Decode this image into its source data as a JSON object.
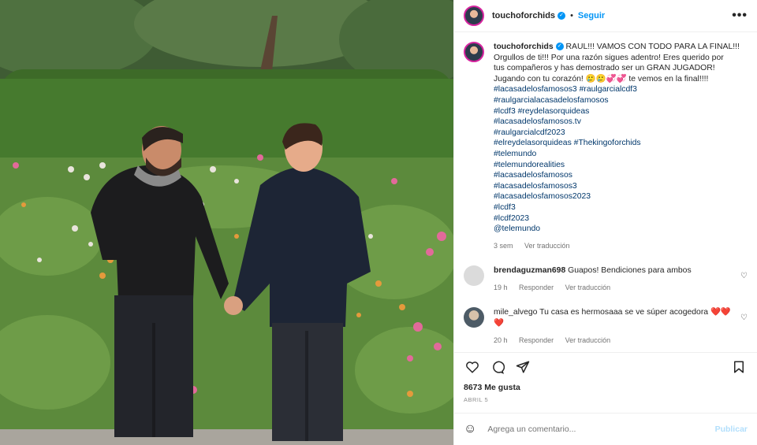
{
  "post": {
    "username": "touchoforchids",
    "follow_label": "Seguir",
    "more_label": "•••",
    "caption_lines": [
      "RAUL!!! VAMOS CON TODO PARA LA FINAL!!!",
      "Orgullos de ti!!! Por una razón sigues adentro! Eres querido por",
      "tus compañeros y has demostrado ser un GRAN JUGADOR!",
      "Jugando con tu corazón! 🥲🥲💞💞 te vemos en la final!!!!"
    ],
    "hashtags": [
      "#lacasadelosfamosos3 #raulgarcialcdf3",
      "#raulgarcialacasadelosfamosos",
      "#lcdf3 #reydelasorquideas",
      "#lacasadelosfamosos.tv",
      "#raulgarcialcdf2023",
      "#elreydelasorquideas #Thekingoforchids",
      "#telemundo",
      "#telemundorealities",
      "#lacasadelosfamosos",
      "#lacasadelosfamosos3",
      "#lacasadelosfamosos2023",
      "#lcdf3",
      "#lcdf2023",
      "@telemundo"
    ],
    "caption_time": "3 sem",
    "translate_label": "Ver traducción",
    "reply_label": "Responder",
    "likes": "8673 Me gusta",
    "date": "ABRIL 5",
    "comment_placeholder": "Agrega un comentario...",
    "publish_label": "Publicar"
  },
  "comments": [
    {
      "user": "brendaguzman698",
      "text": "Guapos! Bendiciones para ambos",
      "time": "19 h"
    },
    {
      "user": "mile_alvego",
      "text": "Tu casa es hermosaaa se ve súper acogedora",
      "hearts": "❤️❤️❤️",
      "time": "20 h"
    }
  ],
  "colors": {
    "accent": "#0095f6",
    "hashtag": "#00376b",
    "muted": "#737373",
    "heart": "#ed4956"
  },
  "icons": [
    "verified-icon",
    "more-options-icon",
    "heart-icon",
    "comment-icon",
    "share-icon",
    "save-icon",
    "emoji-icon"
  ]
}
